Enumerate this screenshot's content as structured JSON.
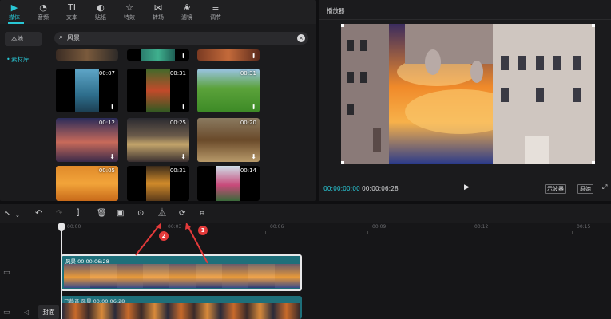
{
  "top_tabs": [
    {
      "label": "媒体",
      "icon": "media-icon",
      "glyph": "▶"
    },
    {
      "label": "音频",
      "icon": "audio-icon",
      "glyph": "◔"
    },
    {
      "label": "文本",
      "icon": "text-icon",
      "glyph": "TI"
    },
    {
      "label": "贴纸",
      "icon": "sticker-icon",
      "glyph": "◐"
    },
    {
      "label": "特效",
      "icon": "effects-icon",
      "glyph": "☆"
    },
    {
      "label": "转场",
      "icon": "transition-icon",
      "glyph": "⋈"
    },
    {
      "label": "滤镜",
      "icon": "filter-icon",
      "glyph": "❀"
    },
    {
      "label": "调节",
      "icon": "adjust-icon",
      "glyph": "≡"
    }
  ],
  "side_nav": {
    "local": "本地",
    "library": "素材库"
  },
  "search": {
    "value": "风景"
  },
  "thumbnails": [
    {
      "duration": "00:07"
    },
    {
      "duration": "00:31"
    },
    {
      "duration": "00:31"
    },
    {
      "duration": "00:12"
    },
    {
      "duration": "00:25"
    },
    {
      "duration": "00:20"
    },
    {
      "duration": "00:05"
    },
    {
      "duration": "00:31"
    },
    {
      "duration": "00:14"
    }
  ],
  "player": {
    "title": "播放器",
    "current_time": "00:00:00:00",
    "total_time": "00:00:06:28",
    "scope_label": "示波器",
    "original_label": "原始"
  },
  "ruler": {
    "labels": [
      "00:00",
      "00:03",
      "00:06",
      "00:09",
      "00:12",
      "00:15"
    ]
  },
  "tracks": {
    "main_label": "风景  00:00:06:28",
    "second_label": "已静音  风景  00:00:06:28",
    "cover_label": "封面"
  },
  "annotations": {
    "badge1": "1",
    "badge2": "2"
  },
  "colors": {
    "accent": "#29c6d4",
    "clip": "#1e6f7a",
    "annotation": "#e33a3a"
  }
}
